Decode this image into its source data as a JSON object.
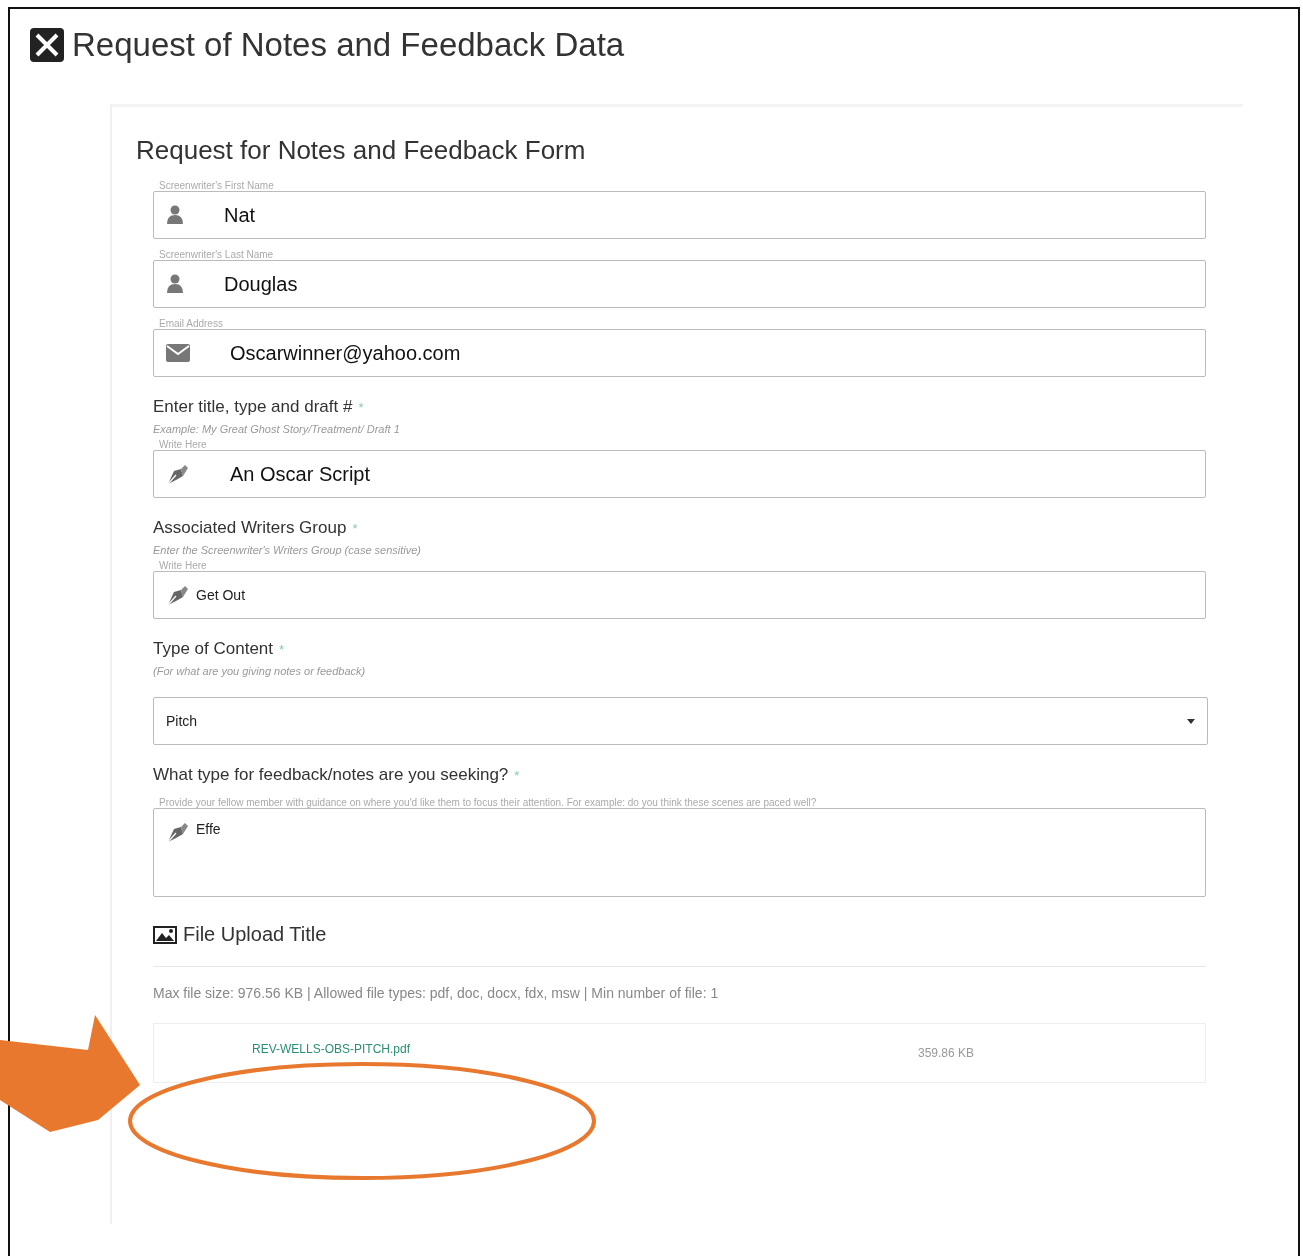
{
  "page_title": "Request of Notes and Feedback Data",
  "form": {
    "title": "Request for Notes and Feedback Form",
    "fields": [
      {
        "kind": "person",
        "label": "Screenwriter's First Name",
        "value": "Nat"
      },
      {
        "kind": "person",
        "label": "Screenwriter's Last Name",
        "value": "Douglas"
      },
      {
        "kind": "email",
        "label": "Email Address",
        "value": "Oscarwinner@yahoo.com"
      },
      {
        "kind": "pen",
        "question": "Enter title, type and draft #",
        "required_mark": "*",
        "hint": "Example: My Great Ghost Story/Treatment/ Draft 1",
        "label": "Write Here",
        "value": "An Oscar Script"
      },
      {
        "kind": "pen-small",
        "question": "Associated Writers Group",
        "required_mark": "*",
        "hint": "Enter the Screenwriter's Writers Group (case sensitive)",
        "label": "Write Here",
        "value": "Get Out"
      },
      {
        "kind": "select",
        "question": "Type of Content",
        "required_mark": "*",
        "hint": "(For what are you giving notes or feedback)",
        "value": "Pitch"
      },
      {
        "kind": "textarea",
        "question": "What type for feedback/notes are you seeking?",
        "required_mark": "*",
        "label": "Provide your fellow member with guidance on where you'd like them to focus their attention. For example: do you think these scenes are paced well?",
        "value": "Effe"
      }
    ],
    "upload": {
      "title": "File Upload Title",
      "info": "Max file size: 976.56 KB | Allowed file types: pdf, doc, docx, fdx, msw | Min number of file: 1",
      "files": [
        {
          "name": "REV-WELLS-OBS-PITCH.pdf",
          "size": "359.86 KB"
        }
      ]
    }
  }
}
